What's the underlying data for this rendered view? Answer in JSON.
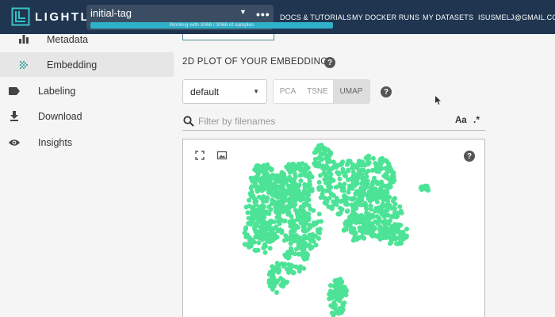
{
  "app": {
    "logo_text": "LIGHTLY"
  },
  "tag_selector": {
    "name": "initial-tag",
    "progress_text": "Working with 3068 / 3068 of samples",
    "progress_fraction": 1.0
  },
  "nav": {
    "docs": "DOCS & TUTORIALS",
    "docker": "MY DOCKER RUNS",
    "datasets": "MY DATASETS",
    "user": "ISUSMELJ@GMAIL.COM"
  },
  "sidebar": {
    "items": [
      {
        "label": "Metadata",
        "icon": "bar-chart-icon"
      },
      {
        "label": "Embedding",
        "icon": "scatter-dots-icon",
        "active": true
      },
      {
        "label": "Labeling",
        "icon": "label-tag-icon"
      },
      {
        "label": "Download",
        "icon": "download-icon"
      },
      {
        "label": "Insights",
        "icon": "eye-icon"
      }
    ]
  },
  "main": {
    "section_title": "2D PLOT OF YOUR EMBEDDING",
    "embedding_select": {
      "value": "default"
    },
    "methods": [
      {
        "label": "PCA",
        "active": false
      },
      {
        "label": "TSNE",
        "active": false
      },
      {
        "label": "UMAP",
        "active": true
      }
    ],
    "filter": {
      "placeholder": "Filter by filenames",
      "case_toggle": "Aa",
      "regex_toggle": ".*"
    },
    "help_glyph": "?"
  },
  "colors": {
    "topbar": "#1f3550",
    "accent": "#2fb2c9",
    "point": "#4de396"
  }
}
